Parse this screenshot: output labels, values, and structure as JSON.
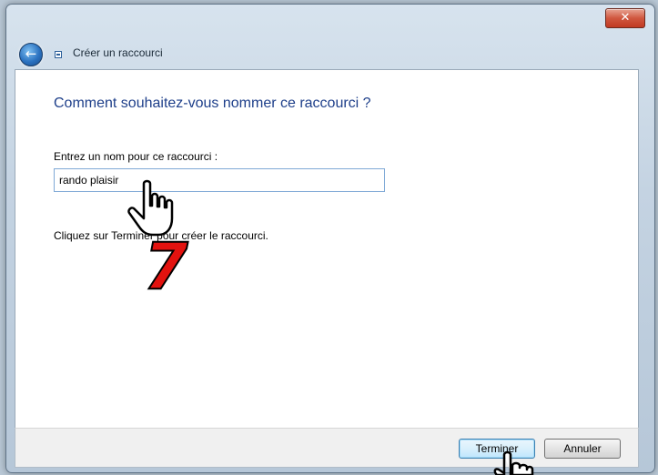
{
  "window": {
    "close_label": "✕",
    "title": "Créer un raccourci",
    "back_icon": "back-arrow-icon",
    "shortcut_icon": "shortcut-icon"
  },
  "main": {
    "heading": "Comment souhaitez-vous nommer ce raccourci ?",
    "field_label": "Entrez un nom pour ce raccourci :",
    "name_value": "rando plaisir",
    "instruction": "Cliquez sur Terminer pour créer le raccourci."
  },
  "footer": {
    "finish_label": "Terminer",
    "cancel_label": "Annuler"
  },
  "overlay": {
    "step_number": "7",
    "cursor_icon": "hand-pointer-icon"
  },
  "colors": {
    "heading": "#1e3f8a",
    "step_number": "#e3120f",
    "close_button": "#c94a33"
  }
}
